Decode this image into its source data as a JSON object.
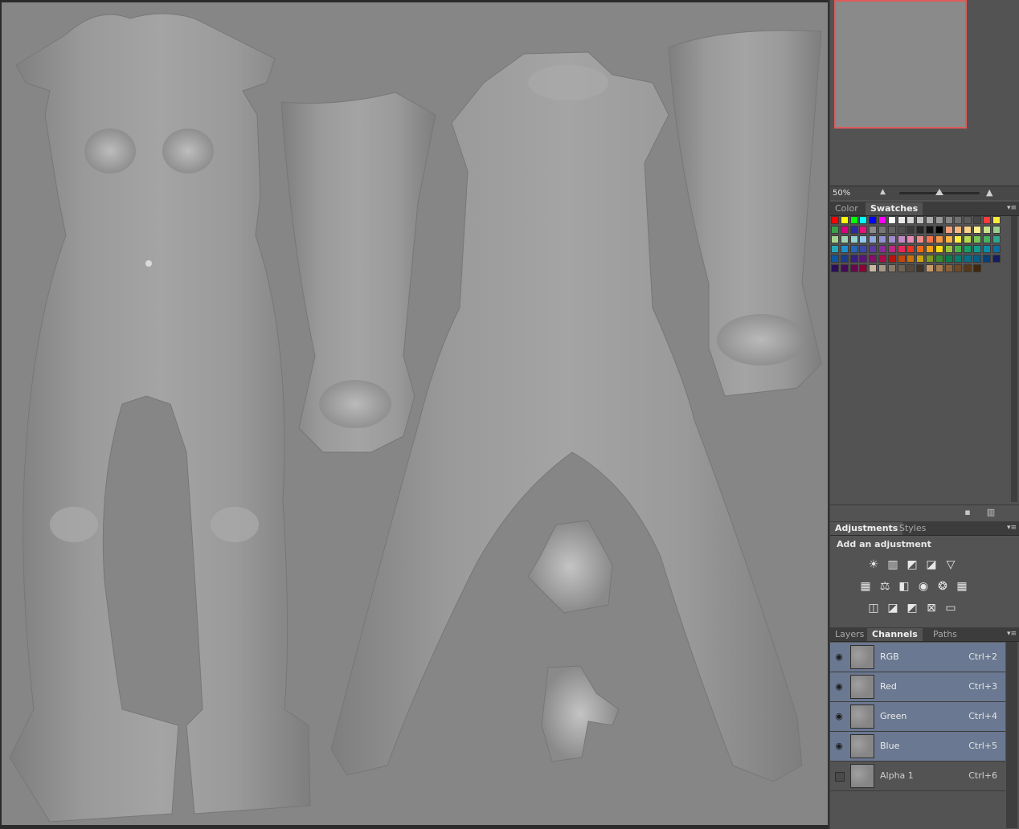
{
  "navigator": {
    "zoom": "50%",
    "zoom_out_icon": "▲",
    "zoom_in_icon": "▲",
    "slider_level": 0.5
  },
  "swatches_panel": {
    "tabs": [
      {
        "label": "Color",
        "active": false
      },
      {
        "label": "Swatches",
        "active": true
      }
    ],
    "colors": [
      [
        "#ff0000",
        "#ffff00",
        "#00ff00",
        "#00ffff",
        "#0000ff",
        "#ff00ff",
        "#ffffff",
        "#ebebeb",
        "#d6d6d6",
        "#c2c2c2",
        "#adadad",
        "#999999",
        "#858585",
        "#707070",
        "#5c5c5c",
        "#474747",
        "#ff3a3a",
        "#ffeb3b"
      ],
      [
        "#3aa04a",
        "#d80080",
        "#2b2ba0",
        "#e0147a",
        "#8c8c8c",
        "#777777",
        "#636363",
        "#4f4f4f",
        "#3b3b3b",
        "#262626",
        "#121212",
        "#000000",
        "#f5a07a",
        "#f7b87f",
        "#fbd28a",
        "#fff08c",
        "#c7e28a",
        "#9ad08a"
      ],
      [
        "#a6d48f",
        "#9fd3b0",
        "#94d4d0",
        "#93c9ea",
        "#8fa9dd",
        "#8e93d0",
        "#a08cc9",
        "#c48ac7",
        "#e88ab3",
        "#ef8a8a",
        "#f4734a",
        "#f79546",
        "#fbb440",
        "#fff23a",
        "#b9dc4a",
        "#79c555",
        "#46b360",
        "#2da88f"
      ],
      [
        "#27a6b8",
        "#1e8fd0",
        "#2466b8",
        "#3b49a8",
        "#5c3aa0",
        "#8a2d9a",
        "#bd2a7e",
        "#e8285a",
        "#ea3320",
        "#ef6a14",
        "#f6a012",
        "#fbdc10",
        "#98c53a",
        "#4ab24a",
        "#12a268",
        "#0d9c8e",
        "#0a8ea8",
        "#0a6fa0"
      ],
      [
        "#0f56a0",
        "#1a3d8c",
        "#361f80",
        "#5c147a",
        "#880e6a",
        "#b00a48",
        "#b8140c",
        "#c2470a",
        "#c8700a",
        "#cca20a",
        "#7c9a1e",
        "#338a32",
        "#0a7e4e",
        "#087c6e",
        "#077088",
        "#075c86",
        "#093f76",
        "#141d62"
      ],
      [
        "#2a0e5a",
        "#470a58",
        "#6a064e",
        "#890336",
        "#c8b8a4",
        "#a89a88",
        "#8a7c6a",
        "#6e6252",
        "#56483a",
        "#3e3226",
        "#c89a6a",
        "#a87c4e",
        "#8a6036",
        "#6e4a26",
        "#563818",
        "#40280e"
      ]
    ],
    "new_icon": "new-swatch-icon",
    "delete_icon": "trash-icon"
  },
  "adjustments_panel": {
    "tabs": [
      {
        "label": "Adjustments",
        "active": true
      },
      {
        "label": "Styles",
        "active": false
      }
    ],
    "title": "Add an adjustment",
    "rows": [
      [
        {
          "name": "brightness-contrast-icon",
          "glyph": "☀"
        },
        {
          "name": "levels-icon",
          "glyph": "▥"
        },
        {
          "name": "curves-icon",
          "glyph": "◩"
        },
        {
          "name": "exposure-icon",
          "glyph": "◪"
        },
        {
          "name": "vibrance-icon",
          "glyph": "▽"
        }
      ],
      [
        {
          "name": "hue-saturation-icon",
          "glyph": "▦"
        },
        {
          "name": "color-balance-icon",
          "glyph": "⚖"
        },
        {
          "name": "black-white-icon",
          "glyph": "◧"
        },
        {
          "name": "photo-filter-icon",
          "glyph": "◉"
        },
        {
          "name": "channel-mixer-icon",
          "glyph": "❂"
        },
        {
          "name": "color-lookup-icon",
          "glyph": "▦"
        }
      ],
      [
        {
          "name": "invert-icon",
          "glyph": "◫"
        },
        {
          "name": "posterize-icon",
          "glyph": "◪"
        },
        {
          "name": "threshold-icon",
          "glyph": "◩"
        },
        {
          "name": "selective-color-icon",
          "glyph": "⊠"
        },
        {
          "name": "gradient-map-icon",
          "glyph": "▭"
        }
      ]
    ]
  },
  "channels_panel": {
    "tabs": [
      {
        "label": "Layers",
        "active": false
      },
      {
        "label": "Channels",
        "active": true
      },
      {
        "label": "Paths",
        "active": false
      }
    ],
    "channels": [
      {
        "name": "RGB",
        "shortcut": "Ctrl+2",
        "visible": true,
        "selected": true
      },
      {
        "name": "Red",
        "shortcut": "Ctrl+3",
        "visible": true,
        "selected": true
      },
      {
        "name": "Green",
        "shortcut": "Ctrl+4",
        "visible": true,
        "selected": true
      },
      {
        "name": "Blue",
        "shortcut": "Ctrl+5",
        "visible": true,
        "selected": true
      },
      {
        "name": "Alpha 1",
        "shortcut": "Ctrl+6",
        "visible": false,
        "selected": false
      }
    ]
  }
}
